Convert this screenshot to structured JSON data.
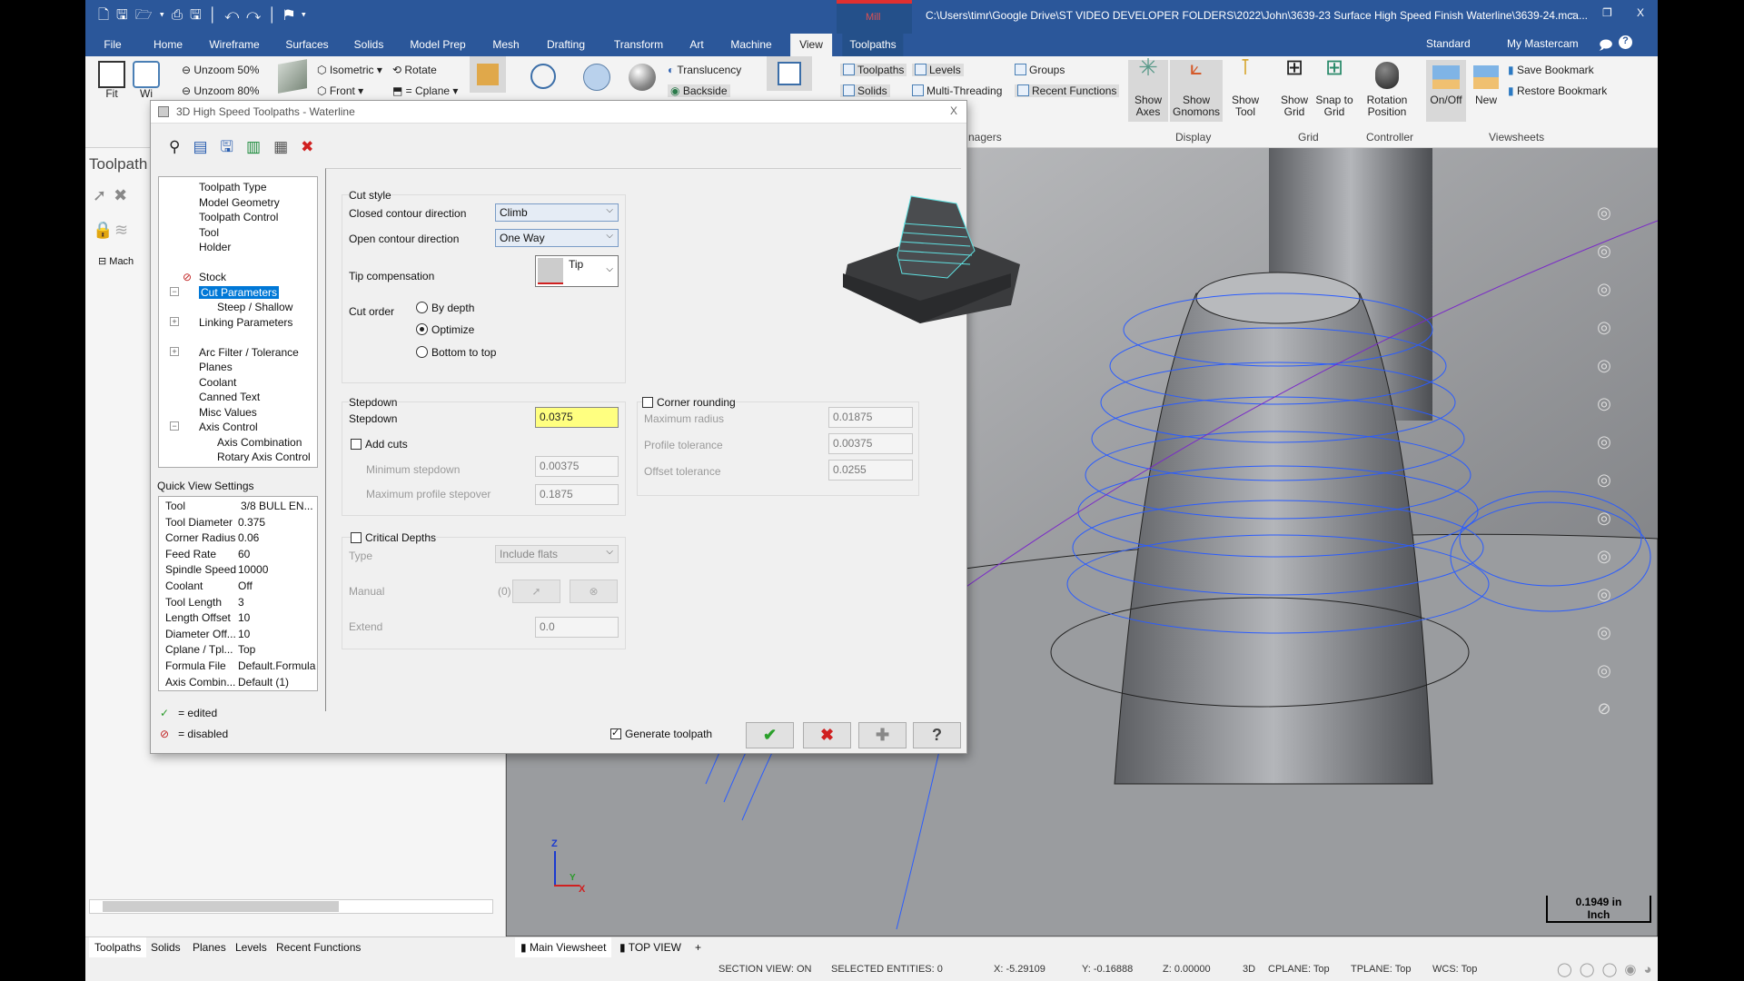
{
  "titlebar": {
    "context_tab": "Mill",
    "path": "C:\\Users\\timr\\Google Drive\\ST VIDEO DEVELOPER FOLDERS\\2022\\John\\3639-23 Surface High Speed Finish Waterline\\3639-24.mca...",
    "minimize": "‒",
    "restore": "❐",
    "close": "X"
  },
  "ribbon_tabs": [
    "File",
    "Home",
    "Wireframe",
    "Surfaces",
    "Solids",
    "Model Prep",
    "Mesh",
    "Drafting",
    "Transform",
    "Art",
    "Machine",
    "View",
    "Toolpaths"
  ],
  "selected_tab": "View",
  "ribbon_right": {
    "workspace": "Standard",
    "my_mastercam": "My Mastercam"
  },
  "ribbon": {
    "fit": "Fit",
    "window": "Wi",
    "unzoom50": "Unzoom 50%",
    "unzoom80": "Unzoom 80%",
    "isometric": "Isometric",
    "rotate": "Rotate",
    "front": "Front",
    "cplane": "= Cplane",
    "translucency": "Translucency",
    "backside": "Backside",
    "toolpaths": "Toolpaths",
    "levels": "Levels",
    "solids": "Solids",
    "multithreading": "Multi-Threading",
    "groups": "Groups",
    "recent_functions": "Recent Functions",
    "managers_group": "nagers",
    "show_axes": "Show Axes",
    "show_gnomons": "Show Gnomons",
    "show_tool": "Show Tool",
    "display_group": "Display",
    "show_grid": "Show Grid",
    "snap_grid": "Snap to Grid",
    "grid_group": "Grid",
    "rotation_position": "Rotation Position",
    "controller_group": "Controller",
    "onoff": "On/Off",
    "new": "New",
    "save_bookmark": "Save Bookmark",
    "restore_bookmark": "Restore Bookmark",
    "viewsheets_group": "Viewsheets"
  },
  "manager": {
    "title": "Toolpath",
    "node": "Mach",
    "bottom_tabs": [
      "Toolpaths",
      "Solids",
      "Planes",
      "Levels",
      "Recent Functions"
    ]
  },
  "dialog": {
    "title": "3D High Speed Toolpaths - Waterline",
    "close": "X",
    "tree": [
      {
        "label": "Toolpath Type",
        "level": 0
      },
      {
        "label": "Model Geometry",
        "level": 0
      },
      {
        "label": "Toolpath Control",
        "level": 0
      },
      {
        "label": "Tool",
        "level": 0
      },
      {
        "label": "Holder",
        "level": 0
      },
      {
        "label": "",
        "level": 0
      },
      {
        "label": "Stock",
        "level": 0,
        "disabled": true
      },
      {
        "label": "Cut Parameters",
        "level": 0,
        "selected": true,
        "expander": "−"
      },
      {
        "label": "Steep / Shallow",
        "level": 1
      },
      {
        "label": "Linking Parameters",
        "level": 0,
        "expander": "+"
      },
      {
        "label": "",
        "level": 0
      },
      {
        "label": "Arc Filter / Tolerance",
        "level": 0,
        "expander": "+"
      },
      {
        "label": "Planes",
        "level": 0
      },
      {
        "label": "Coolant",
        "level": 0
      },
      {
        "label": "Canned Text",
        "level": 0
      },
      {
        "label": "Misc Values",
        "level": 0
      },
      {
        "label": "Axis Control",
        "level": 0,
        "expander": "−"
      },
      {
        "label": "Axis Combination",
        "level": 1
      },
      {
        "label": "Rotary Axis Control",
        "level": 1
      }
    ],
    "quick_view_title": "Quick View Settings",
    "quick_view": [
      [
        "Tool",
        "3/8 BULL EN..."
      ],
      [
        "Tool Diameter",
        "0.375"
      ],
      [
        "Corner Radius",
        "0.06"
      ],
      [
        "Feed Rate",
        "60"
      ],
      [
        "Spindle Speed",
        "10000"
      ],
      [
        "Coolant",
        "Off"
      ],
      [
        "Tool Length",
        "3"
      ],
      [
        "Length Offset",
        "10"
      ],
      [
        "Diameter Off...",
        "10"
      ],
      [
        "Cplane / Tpl...",
        "Top"
      ],
      [
        "Formula File",
        "Default.Formula"
      ],
      [
        "Axis Combin...",
        "Default (1)"
      ]
    ],
    "legend_edited": "= edited",
    "legend_disabled": "= disabled",
    "cut_style": {
      "group": "Cut style",
      "closed_label": "Closed contour direction",
      "closed_value": "Climb",
      "open_label": "Open contour direction",
      "open_value": "One Way",
      "tip_label": "Tip compensation",
      "tip_value": "Tip",
      "cut_order_label": "Cut order",
      "cut_order_options": [
        "By depth",
        "Optimize",
        "Bottom to top"
      ],
      "cut_order_selected": "Optimize"
    },
    "stepdown": {
      "group": "Stepdown",
      "label": "Stepdown",
      "value": "0.0375",
      "add_cuts": "Add cuts",
      "add_cuts_checked": false,
      "min_label": "Minimum stepdown",
      "min_value": "0.00375",
      "max_label": "Maximum profile stepover",
      "max_value": "0.1875"
    },
    "corner": {
      "label": "Corner rounding",
      "checked": false,
      "max_radius_label": "Maximum radius",
      "max_radius": "0.01875",
      "profile_tol_label": "Profile tolerance",
      "profile_tol": "0.00375",
      "offset_tol_label": "Offset tolerance",
      "offset_tol": "0.0255"
    },
    "critical": {
      "label": "Critical Depths",
      "checked": false,
      "type_label": "Type",
      "type_value": "Include flats",
      "manual_label": "Manual",
      "manual_count": "(0)",
      "extend_label": "Extend",
      "extend_value": "0.0"
    },
    "generate_label": "Generate toolpath",
    "generate_checked": true,
    "ok": "✔",
    "cancel": "✖",
    "add": "✚",
    "help": "?"
  },
  "viewport": {
    "scale_value": "0.1949 in",
    "scale_unit": "Inch",
    "axis_z": "Z",
    "axis_y": "Y",
    "axis_x": "X"
  },
  "viewsheets": {
    "main": "Main Viewsheet",
    "top": "TOP VIEW",
    "add": "+"
  },
  "status": {
    "section_view": "SECTION VIEW: ON",
    "selected": "SELECTED ENTITIES: 0",
    "x": "X:  -5.29109",
    "y": "Y:  -0.16888",
    "z": "Z:  0.00000",
    "mode": "3D",
    "cplane": "CPLANE: Top",
    "tplane": "TPLANE: Top",
    "wcs": "WCS: Top"
  },
  "colors": {
    "title_blue": "#2b579a",
    "mill_red": "#e03030",
    "selected_tree": "#0078d7",
    "stepdown_highlight": "#ffff80",
    "toolpath_blue": "#2a5cff"
  }
}
